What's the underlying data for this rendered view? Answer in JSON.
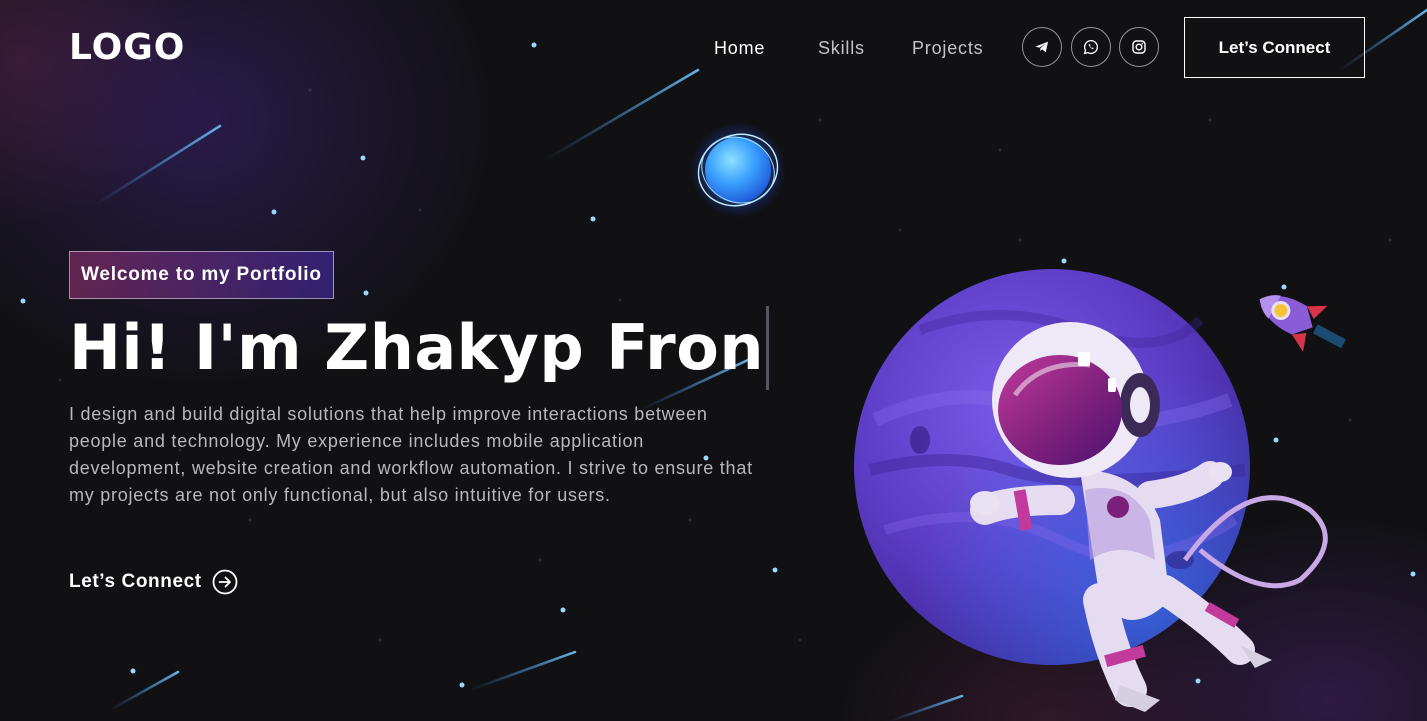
{
  "nav": {
    "logo": "LOGO",
    "links": [
      {
        "label": "Home",
        "active": true
      },
      {
        "label": "Skills",
        "active": false
      },
      {
        "label": "Projects",
        "active": false
      }
    ],
    "social": [
      {
        "icon": "telegram-icon"
      },
      {
        "icon": "whatsapp-icon"
      },
      {
        "icon": "instagram-icon"
      }
    ],
    "connect_label": "Let’s Connect"
  },
  "hero": {
    "tagline": "Welcome to my Portfolio",
    "headline": "Hi! I'm Zhakyp Fron",
    "description": "I design and build digital solutions that help improve interactions between people and technology. My experience includes mobile application development, website creation and workflow automation. I strive to ensure that my projects are not only functional, but also intuitive for users.",
    "cta_label": "Let’s Connect",
    "cta_icon": "arrow-right-circle-icon"
  },
  "colors": {
    "background": "#111114",
    "tagline_gradient_start": "#aa367c",
    "tagline_gradient_end": "#4a2fbd",
    "planet": "#5b3cc4",
    "text_muted": "#b8b8b8"
  }
}
